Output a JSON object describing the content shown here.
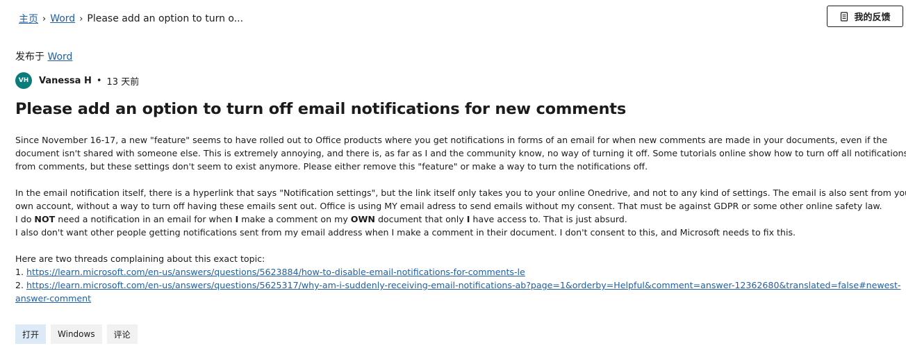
{
  "breadcrumb": {
    "home": "主页",
    "product": "Word",
    "current": "Please add an option to turn o...",
    "separator": "›"
  },
  "header": {
    "feedback_button": "我的反馈",
    "feedback_icon": "document-icon"
  },
  "post": {
    "posted_in_label": "发布于",
    "posted_in_link": "Word",
    "author_initials": "VH",
    "author_name": "Vanessa H",
    "age": "13 天前",
    "title": "Please add an option to turn off email notifications for new comments",
    "p1": [
      "Since November 16-17, a new \"feature\" seems to have rolled out to Office products where you get notifications in forms of an email for when new comments are made in your documents, even if the",
      "document isn't shared with someone else. This is extremely annoying, and there is, as far as I and the community know, no way of turning it off. Some tutorials online show how to turn off all notifications",
      "from comments, but these settings don't seem to exist anymore. Please either remove this \"feature\" or make a way to turn the notifications off."
    ],
    "p2": [
      "In the email notification itself, there is a hyperlink that says \"Notification settings\", but the link itself only takes you to your online Onedrive, and not to any kind of settings. The email is also sent from your",
      "own account, without a way to turn off having these emails sent out. Office is using MY email adress to send emails without my consent. That must be against GDPR or some other online safety law."
    ],
    "p3_parts": [
      "I do ",
      "NOT",
      " need a notification in an email for when ",
      "I",
      " make a comment on my ",
      "OWN",
      " document that only ",
      "I",
      " have access to. That is just absurd."
    ],
    "p4": "I also don't want other people getting notifications sent from my email address when I make a comment in their document. I don't consent to this, and Microsoft needs to fix this.",
    "threads_intro": "Here are two threads complaining about this exact topic:",
    "link1_prefix": "1. ",
    "link1": "https://learn.microsoft.com/en-us/answers/questions/5623884/how-to-disable-email-notifications-for-comments-le",
    "link2_prefix": "2. ",
    "link2_line1": "https://learn.microsoft.com/en-us/answers/questions/5625317/why-am-i-suddenly-receiving-email-notifications-ab?page=1&orderby=Helpful&comment=answer-12362680&translated=false#newest-",
    "link2_line2": "answer-comment"
  },
  "tags": [
    "打开",
    "Windows",
    "评论"
  ],
  "colors": {
    "link": "#1f5fa6",
    "avatar": "#0b7c7c",
    "open_tag": "#dce9f7",
    "tag": "#f1f1f1"
  }
}
